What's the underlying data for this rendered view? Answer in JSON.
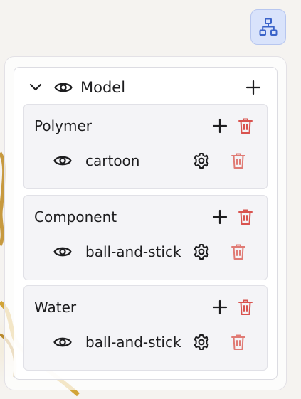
{
  "toolbar": {
    "toggle_icon": "hierarchy-icon"
  },
  "model": {
    "label": "Model",
    "collapse_icon": "chevron-down-icon",
    "visibility_icon": "eye-icon",
    "add_icon": "plus-icon"
  },
  "components": [
    {
      "label": "Polymer",
      "representation": "cartoon"
    },
    {
      "label": "Component",
      "representation": "ball-and-stick"
    },
    {
      "label": "Water",
      "representation": "ball-and-stick"
    }
  ],
  "colors": {
    "accent_button_bg": "#d9e3fb",
    "accent_button_border": "#b7c6ef",
    "accent_icon": "#3a63c9",
    "delete": "#d9534f",
    "delete_light": "#e07a74"
  }
}
